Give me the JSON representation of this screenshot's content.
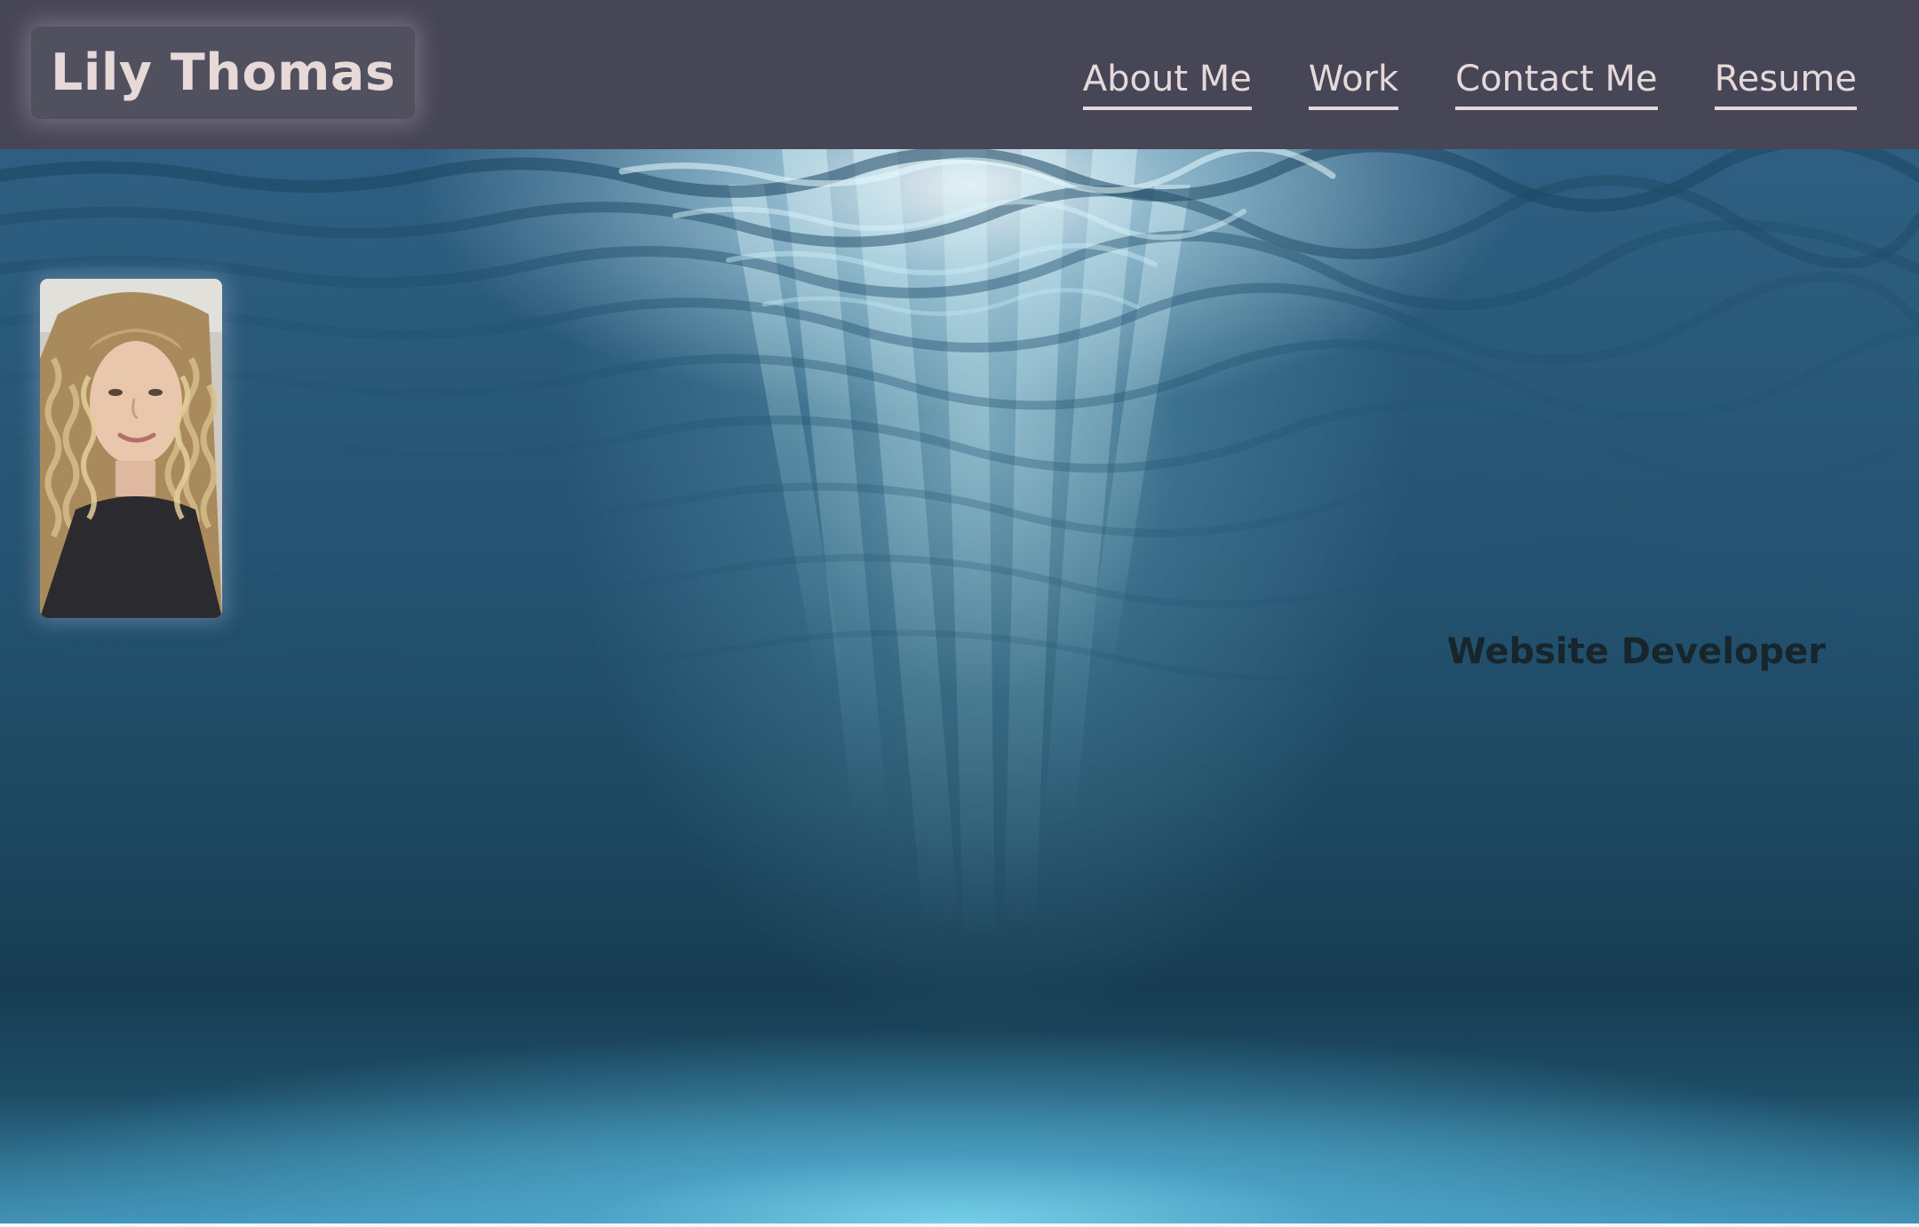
{
  "header": {
    "brand_name": "Lily Thomas",
    "nav": [
      {
        "label": "About Me"
      },
      {
        "label": "Work"
      },
      {
        "label": "Contact Me"
      },
      {
        "label": "Resume"
      }
    ]
  },
  "hero": {
    "tagline": "Website Developer",
    "background_image": "underwater-sun-rays",
    "portrait_image": "profile-photo"
  },
  "colors": {
    "header_bg": "#474656",
    "brand_box_bg": "#51505f",
    "nav_text": "#e6d9da",
    "tagline_text": "#16262c",
    "water_dark": "#173c52",
    "water_light": "#3e8fb3"
  }
}
